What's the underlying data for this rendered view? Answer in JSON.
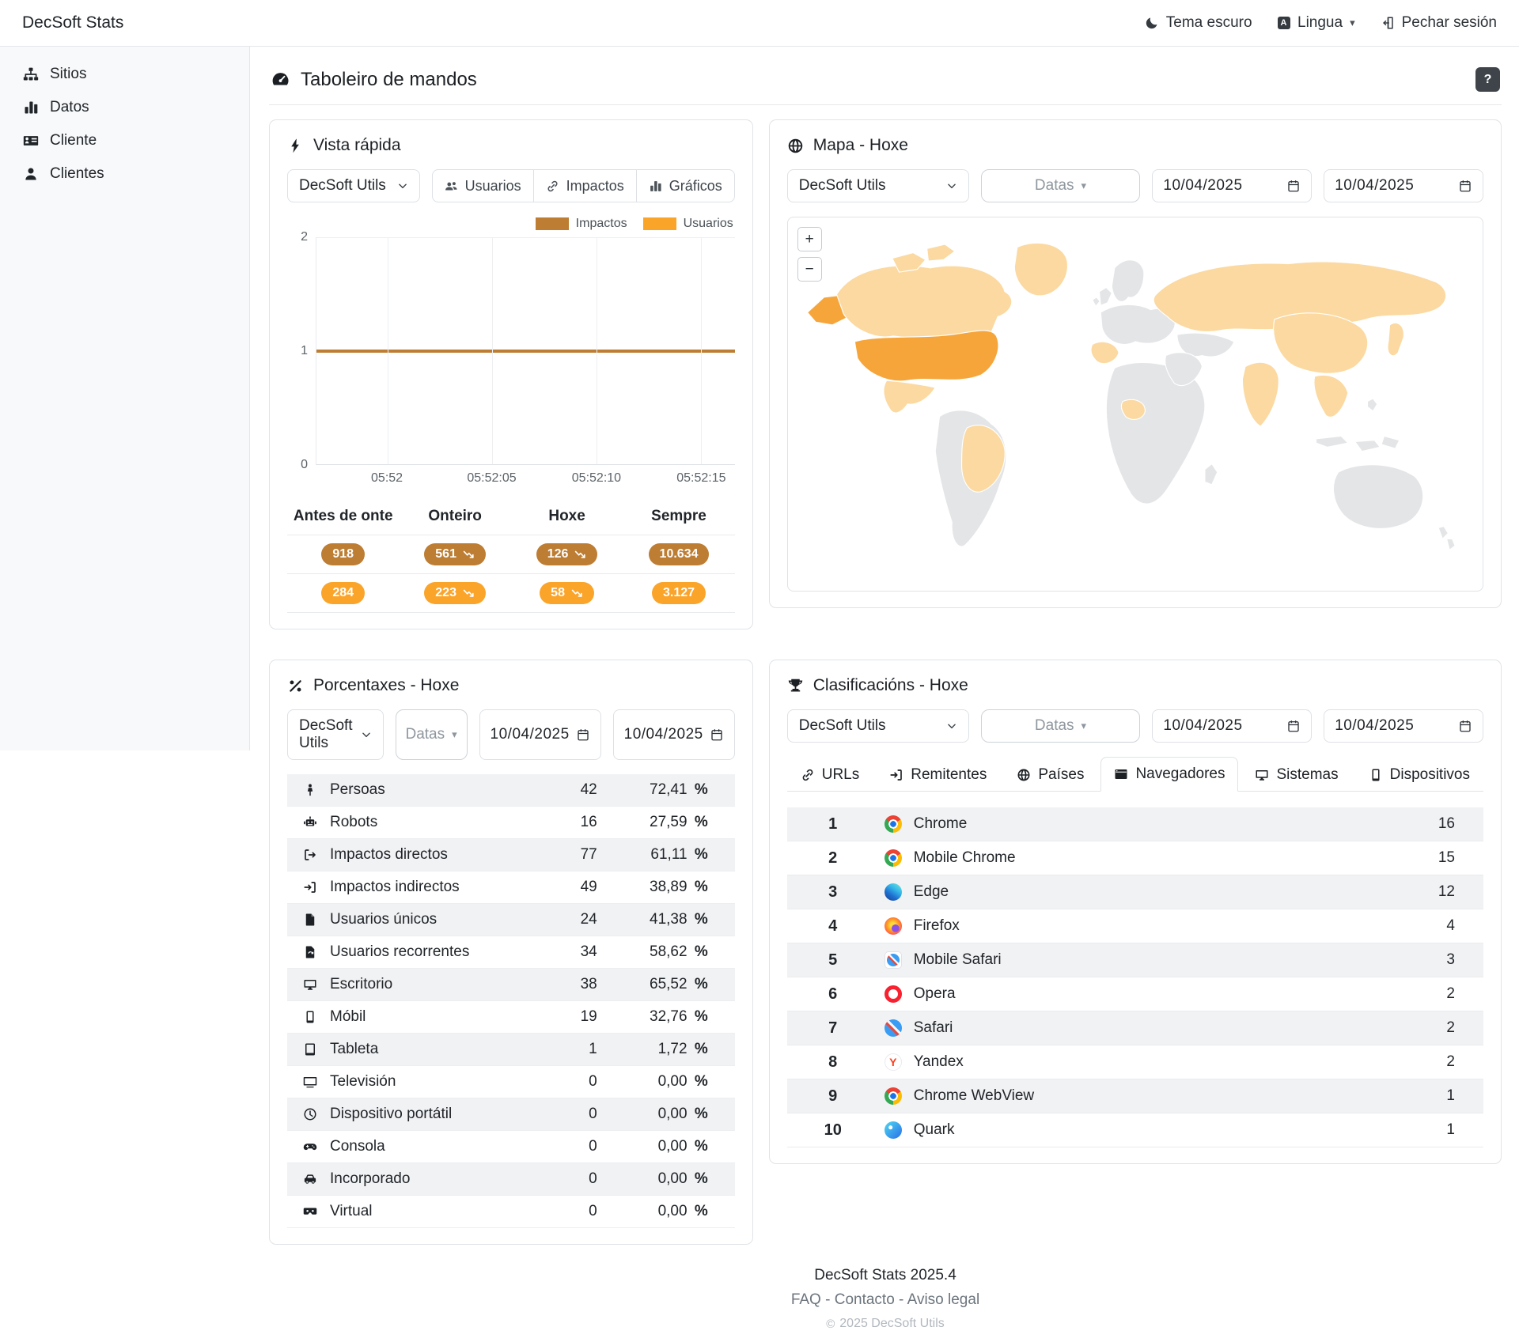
{
  "navbar": {
    "brand": "DecSoft Stats",
    "theme_toggle": "Tema escuro",
    "language": "Lingua",
    "logout": "Pechar sesión"
  },
  "sidebar": {
    "items": [
      {
        "icon": "sitemap-icon",
        "label": "Sitios"
      },
      {
        "icon": "bar-chart-icon",
        "label": "Datos"
      },
      {
        "icon": "id-card-icon",
        "label": "Cliente"
      },
      {
        "icon": "user-icon",
        "label": "Clientes"
      }
    ]
  },
  "page": {
    "title": "Taboleiro de mandos",
    "help": "?"
  },
  "quick_view": {
    "title": "Vista rápida",
    "site_select": "DecSoft Utils",
    "view_buttons": [
      {
        "icon": "users-icon",
        "label": "Usuarios"
      },
      {
        "icon": "link-icon",
        "label": "Impactos"
      },
      {
        "icon": "chart-icon",
        "label": "Gráficos"
      }
    ],
    "stats": {
      "headers": [
        "Antes de onte",
        "Onteiro",
        "Hoxe",
        "Sempre"
      ],
      "impactos": [
        {
          "value": "918",
          "trend_down": false
        },
        {
          "value": "561",
          "trend_down": true
        },
        {
          "value": "126",
          "trend_down": true
        },
        {
          "value": "10.634",
          "trend_down": false
        }
      ],
      "usuarios": [
        {
          "value": "284",
          "trend_down": false
        },
        {
          "value": "223",
          "trend_down": true
        },
        {
          "value": "58",
          "trend_down": true
        },
        {
          "value": "3.127",
          "trend_down": false
        }
      ]
    }
  },
  "chart_data": {
    "type": "line",
    "x_labels": [
      "05:52",
      "05:52:05",
      "05:52:10",
      "05:52:15"
    ],
    "y_ticks": [
      "2",
      "1",
      "0"
    ],
    "ylim": [
      0,
      2
    ],
    "grid": true,
    "legend_position": "top-right",
    "series": [
      {
        "name": "Impactos",
        "color": "#bd7d33",
        "values": [
          1,
          1,
          1,
          1
        ]
      },
      {
        "name": "Usuarios",
        "color": "#fba42a",
        "values": []
      }
    ]
  },
  "map_card": {
    "title": "Mapa - Hoxe",
    "site_select": "DecSoft Utils",
    "datas_label": "Datas",
    "date_from": "10/04/2025",
    "date_to": "10/04/2025",
    "zoom_in": "+",
    "zoom_out": "−"
  },
  "percent_card": {
    "title": "Porcentaxes - Hoxe",
    "site_select": "DecSoft Utils",
    "datas_label": "Datas",
    "date_from": "10/04/2025",
    "date_to": "10/04/2025",
    "rows": [
      {
        "icon": "person-icon",
        "label": "Persoas",
        "value": "42",
        "percent": "72,41"
      },
      {
        "icon": "robot-icon",
        "label": "Robots",
        "value": "16",
        "percent": "27,59"
      },
      {
        "icon": "out-bracket-icon",
        "label": "Impactos directos",
        "value": "77",
        "percent": "61,11"
      },
      {
        "icon": "in-bracket-icon",
        "label": "Impactos indirectos",
        "value": "49",
        "percent": "38,89"
      },
      {
        "icon": "file-icon",
        "label": "Usuarios únicos",
        "value": "24",
        "percent": "41,38"
      },
      {
        "icon": "file-refresh-icon",
        "label": "Usuarios recorrentes",
        "value": "34",
        "percent": "58,62"
      },
      {
        "icon": "desktop-icon",
        "label": "Escritorio",
        "value": "38",
        "percent": "65,52"
      },
      {
        "icon": "mobile-icon",
        "label": "Móbil",
        "value": "19",
        "percent": "32,76"
      },
      {
        "icon": "tablet-icon",
        "label": "Tableta",
        "value": "1",
        "percent": "1,72"
      },
      {
        "icon": "tv-icon",
        "label": "Televisión",
        "value": "0",
        "percent": "0,00"
      },
      {
        "icon": "clock-icon",
        "label": "Dispositivo portátil",
        "value": "0",
        "percent": "0,00"
      },
      {
        "icon": "gamepad-icon",
        "label": "Consola",
        "value": "0",
        "percent": "0,00"
      },
      {
        "icon": "car-icon",
        "label": "Incorporado",
        "value": "0",
        "percent": "0,00"
      },
      {
        "icon": "vr-icon",
        "label": "Virtual",
        "value": "0",
        "percent": "0,00"
      }
    ]
  },
  "rankings_card": {
    "title": "Clasificacións - Hoxe",
    "site_select": "DecSoft Utils",
    "datas_label": "Datas",
    "date_from": "10/04/2025",
    "date_to": "10/04/2025",
    "tabs": [
      {
        "icon": "link-icon",
        "label": "URLs",
        "active": false
      },
      {
        "icon": "in-bracket-icon",
        "label": "Remitentes",
        "active": false
      },
      {
        "icon": "globe-icon",
        "label": "Países",
        "active": false
      },
      {
        "icon": "browser-icon",
        "label": "Navegadores",
        "active": true
      },
      {
        "icon": "desktop-icon",
        "label": "Sistemas",
        "active": false
      },
      {
        "icon": "mobile-icon",
        "label": "Dispositivos",
        "active": false
      }
    ],
    "rows": [
      {
        "rank": "1",
        "icon": "chrome-icon",
        "label": "Chrome",
        "value": "16"
      },
      {
        "rank": "2",
        "icon": "chrome-icon",
        "label": "Mobile Chrome",
        "value": "15"
      },
      {
        "rank": "3",
        "icon": "edge-icon",
        "label": "Edge",
        "value": "12"
      },
      {
        "rank": "4",
        "icon": "firefox-icon",
        "label": "Firefox",
        "value": "4"
      },
      {
        "rank": "5",
        "icon": "mobile-safari-icon",
        "label": "Mobile Safari",
        "value": "3"
      },
      {
        "rank": "6",
        "icon": "opera-icon",
        "label": "Opera",
        "value": "2"
      },
      {
        "rank": "7",
        "icon": "safari-icon",
        "label": "Safari",
        "value": "2"
      },
      {
        "rank": "8",
        "icon": "yandex-icon",
        "label": "Yandex",
        "value": "2"
      },
      {
        "rank": "9",
        "icon": "chrome-icon",
        "label": "Chrome WebView",
        "value": "1"
      },
      {
        "rank": "10",
        "icon": "quark-icon",
        "label": "Quark",
        "value": "1"
      }
    ]
  },
  "footer": {
    "version": "DecSoft Stats 2025.4",
    "links": [
      "FAQ",
      "Contacto",
      "Aviso legal"
    ],
    "separator": " - ",
    "copyright": "2025 DecSoft Utils"
  },
  "colors": {
    "impactos": "#bd7d33",
    "usuarios": "#fba42a",
    "map_country_strong": "#f6a53b",
    "map_country_light": "#fbd9a1",
    "map_country_default": "#e4e5e7",
    "help_button": "#3e444a"
  }
}
